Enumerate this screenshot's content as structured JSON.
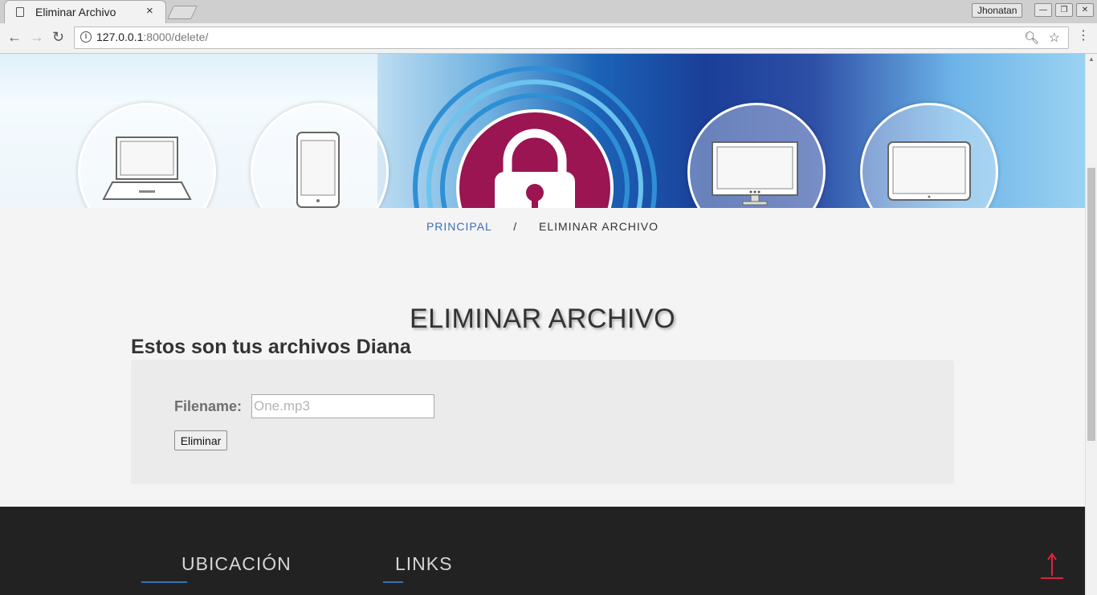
{
  "browser": {
    "tab_title": "Eliminar Archivo",
    "tab_close": "×",
    "profile_name": "Jhonatan",
    "window_controls": {
      "minimize": "—",
      "restore": "❐",
      "close": "✕"
    },
    "back": "←",
    "forward": "→",
    "reload": "↻",
    "url_host": "127.0.0.1",
    "url_rest": ":8000/delete/",
    "info_glyph": "i",
    "zoom_glyph": "🔍︎",
    "star_glyph": "☆",
    "menu_glyph": "⋮"
  },
  "breadcrumb": {
    "home": "PRINCIPAL",
    "separator": "/",
    "current": "ELIMINAR ARCHIVO"
  },
  "main": {
    "heading": "ELIMINAR ARCHIVO",
    "files_title": "Estos son tus archivos Diana",
    "form": {
      "filename_label": "Filename:",
      "filename_placeholder": "One.mp3",
      "filename_value": "",
      "submit_label": "Eliminar"
    }
  },
  "footer": {
    "location_heading": "UBICACIÓN",
    "links_heading": "LINKS"
  },
  "colors": {
    "accent_blue": "#3a6fb5",
    "footer_bg": "#222222",
    "lock_magenta": "#9a1552",
    "scroll_top_red": "#e0223c"
  },
  "icons": [
    "page-icon",
    "info-icon",
    "zoom-icon",
    "star-icon",
    "menu-icon",
    "laptop-icon",
    "phone-icon",
    "lock-icon",
    "monitor-icon",
    "tablet-icon",
    "scroll-top-icon"
  ]
}
